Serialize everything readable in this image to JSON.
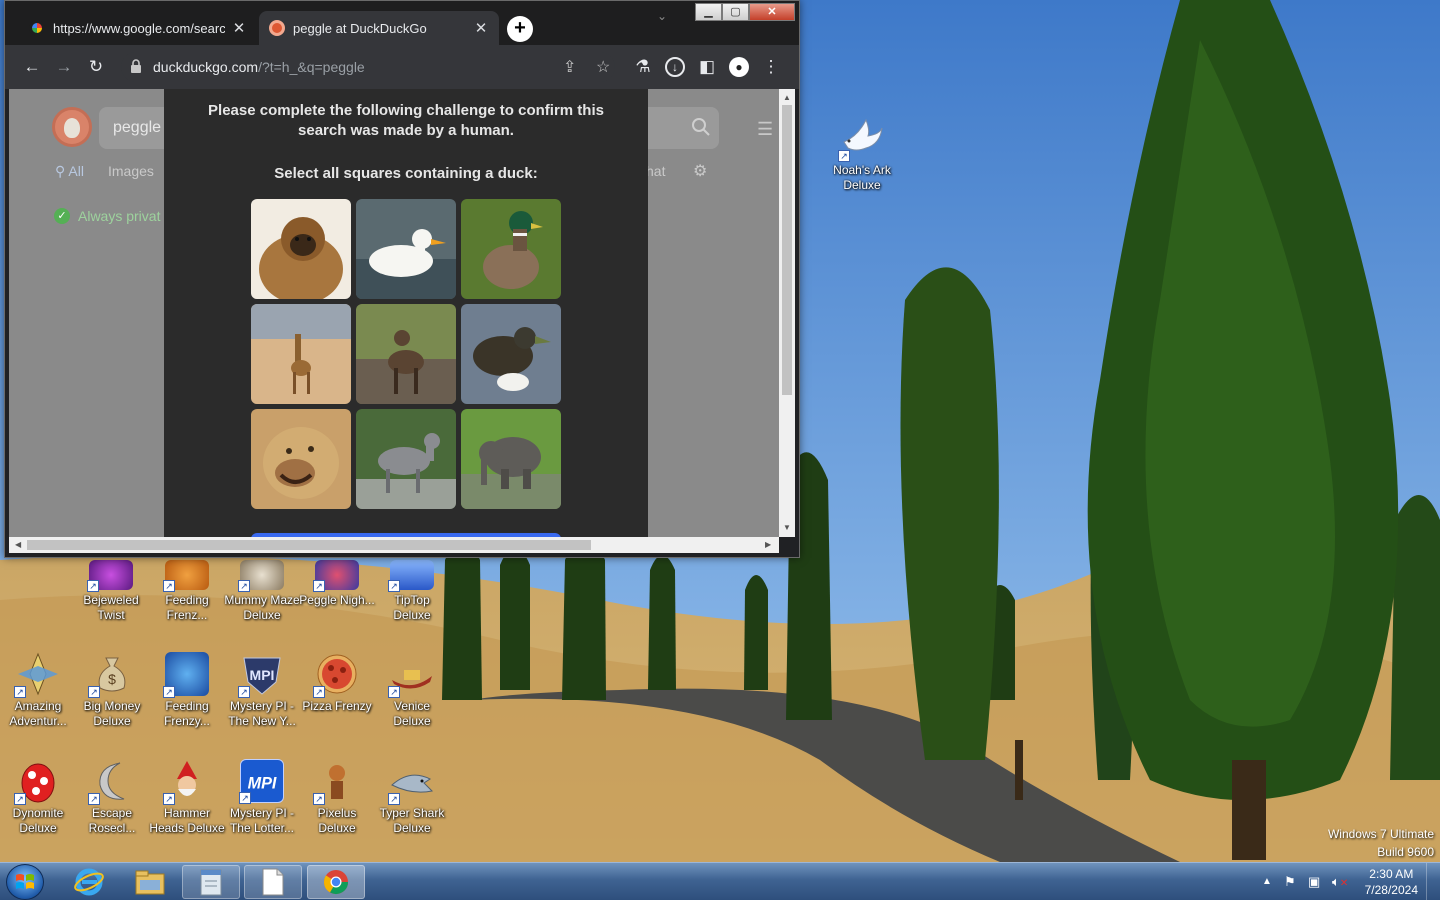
{
  "browser": {
    "tabs": [
      {
        "title": "https://www.google.com/search?",
        "favicon": "google-icon",
        "active": false
      },
      {
        "title": "peggle at DuckDuckGo",
        "favicon": "duckduckgo-icon",
        "active": true
      }
    ],
    "new_tab_label": "+",
    "address": {
      "host": "duckduckgo.com",
      "path": "/?t=h_&q=peggle"
    }
  },
  "page": {
    "search_query": "peggle",
    "nav_tabs": [
      "All",
      "Images"
    ],
    "chat_tab": "hat",
    "privacy_text": "Always privat",
    "challenge": {
      "message": "Please complete the following challenge to confirm this search was made by a human.",
      "prompt": "Select all squares containing a duck:",
      "images": [
        "gibbon",
        "white duck",
        "mallard duck",
        "giraffe",
        "waterbuck",
        "duck",
        "lioness",
        "nilgai",
        "elephant"
      ]
    }
  },
  "desktop": {
    "icons": [
      {
        "label": "Noah's Ark Deluxe",
        "icon": "dove-icon"
      },
      {
        "label": "Bejeweled Twist",
        "icon": "gem-icon"
      },
      {
        "label": "Feeding Frenz...",
        "icon": "fish-icon"
      },
      {
        "label": "Mummy Maze Deluxe",
        "icon": "mummy-icon"
      },
      {
        "label": "Peggle Nigh...",
        "icon": "peggle-icon"
      },
      {
        "label": "TipTop Deluxe",
        "icon": "tiptop-icon"
      },
      {
        "label": "Amazing Adventur...",
        "icon": "compass-icon"
      },
      {
        "label": "Big Money Deluxe",
        "icon": "money-bag-icon"
      },
      {
        "label": "Feeding Frenzy...",
        "icon": "fish-icon"
      },
      {
        "label": "Mystery PI - The New Y...",
        "icon": "mystery-pi-icon"
      },
      {
        "label": "Pizza Frenzy",
        "icon": "pizza-icon"
      },
      {
        "label": "Venice Deluxe",
        "icon": "gondola-icon"
      },
      {
        "label": "Dynomite Deluxe",
        "icon": "egg-icon"
      },
      {
        "label": "Escape Rosecl...",
        "icon": "moon-icon"
      },
      {
        "label": "Hammer Heads Deluxe",
        "icon": "gnome-icon"
      },
      {
        "label": "Mystery PI - The Lotter...",
        "icon": "mystery-pi-icon"
      },
      {
        "label": "Pixelus Deluxe",
        "icon": "pixelus-icon"
      },
      {
        "label": "Typer Shark Deluxe",
        "icon": "shark-icon"
      }
    ],
    "watermark": [
      "Windows 7 Ultimate",
      "Build 9600"
    ]
  },
  "taskbar": {
    "clock_time": "2:30 AM",
    "clock_date": "7/28/2024"
  },
  "colors": {
    "accent": "#3969ef",
    "sky": "#5e97d9",
    "taskbar": "#3f6392"
  }
}
